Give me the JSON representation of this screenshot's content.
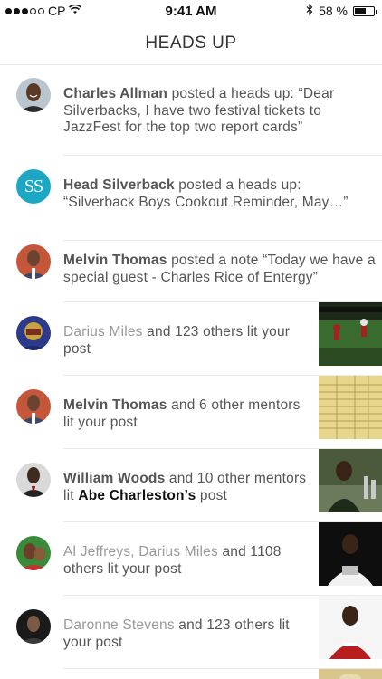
{
  "status_bar": {
    "carrier": "CP",
    "time": "9:41 AM",
    "battery_percent_label": "58 %",
    "battery_level": 0.58,
    "signal_bars_filled": 3,
    "signal_bars_total": 5
  },
  "header": {
    "title": "HEADS UP"
  },
  "feed": [
    {
      "name": "Charles Allman",
      "text": " posted a heads up: “Dear Silverbacks, I have two festival tickets to JazzFest for the top two report cards”"
    },
    {
      "name": "Head Silverback",
      "text": " posted a heads up: “Silverback Boys Cookout Reminder, May…”",
      "avatar_initials": "SS"
    },
    {
      "name": "Melvin Thomas",
      "text": " posted a note “Today we have a special guest - Charles Rice of Entergy”"
    },
    {
      "name": "Darius Miles",
      "text": "  and 123 others lit your post"
    },
    {
      "name": "Melvin Thomas",
      "text": " and 6 other mentors lit your post"
    },
    {
      "name": "William Woods",
      "text": " and 10 other mentors lit ",
      "target": "Abe Charleston’s",
      "text_after": " post"
    },
    {
      "name": "Al Jeffreys, Darius Miles",
      "text": "  and 1108 others lit your post"
    },
    {
      "name": "Daronne Stevens",
      "text": "  and 123 others lit your post"
    }
  ],
  "colors": {
    "accent_teal": "#1ea7c5",
    "text": "#555555",
    "muted": "#999999",
    "divider": "#eaeaea"
  }
}
